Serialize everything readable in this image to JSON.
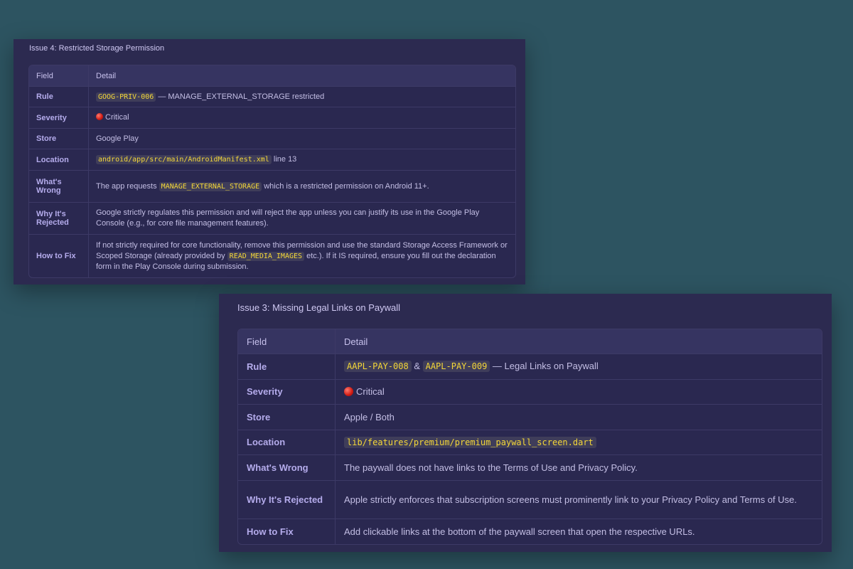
{
  "issue4": {
    "title": "Issue 4: Restricted Storage Permission",
    "header": {
      "field": "Field",
      "detail": "Detail"
    },
    "rule": {
      "label": "Rule",
      "code": "GOOG-PRIV-006",
      "text": " — MANAGE_EXTERNAL_STORAGE restricted"
    },
    "severity": {
      "label": "Severity",
      "icon": "red-circle-icon",
      "text": "Critical"
    },
    "store": {
      "label": "Store",
      "text": "Google Play"
    },
    "location": {
      "label": "Location",
      "code": "android/app/src/main/AndroidManifest.xml",
      "text": " line 13"
    },
    "wrong": {
      "label": "What's Wrong",
      "pre": "The app requests ",
      "code": "MANAGE_EXTERNAL_STORAGE",
      "post": " which is a restricted permission on Android 11+."
    },
    "rejected": {
      "label": "Why It's Rejected",
      "text": "Google strictly regulates this permission and will reject the app unless you can justify its use in the Google Play Console (e.g., for core file management features)."
    },
    "fix": {
      "label": "How to Fix",
      "pre": "If not strictly required for core functionality, remove this permission and use the standard Storage Access Framework or Scoped Storage (already provided by ",
      "code": "READ_MEDIA_IMAGES",
      "post": " etc.). If it IS required, ensure you fill out the declaration form in the Play Console during submission."
    }
  },
  "issue3": {
    "title": "Issue 3: Missing Legal Links on Paywall",
    "header": {
      "field": "Field",
      "detail": "Detail"
    },
    "rule": {
      "label": "Rule",
      "code1": "AAPL-PAY-008",
      "amp": " & ",
      "code2": "AAPL-PAY-009",
      "text": " — Legal Links on Paywall"
    },
    "severity": {
      "label": "Severity",
      "icon": "red-circle-icon",
      "text": "Critical"
    },
    "store": {
      "label": "Store",
      "text": "Apple / Both"
    },
    "location": {
      "label": "Location",
      "code": "lib/features/premium/premium_paywall_screen.dart"
    },
    "wrong": {
      "label": "What's Wrong",
      "text": "The paywall does not have links to the Terms of Use and Privacy Policy."
    },
    "rejected": {
      "label": "Why It's Rejected",
      "text": "Apple strictly enforces that subscription screens must prominently link to your Privacy Policy and Terms of Use."
    },
    "fix": {
      "label": "How to Fix",
      "text": "Add clickable links at the bottom of the paywall screen that open the respective URLs."
    }
  },
  "colors": {
    "background": "#2d5461",
    "card": "#2c2a50",
    "code_text": "#f4d738",
    "field_text": "#b5acec"
  }
}
